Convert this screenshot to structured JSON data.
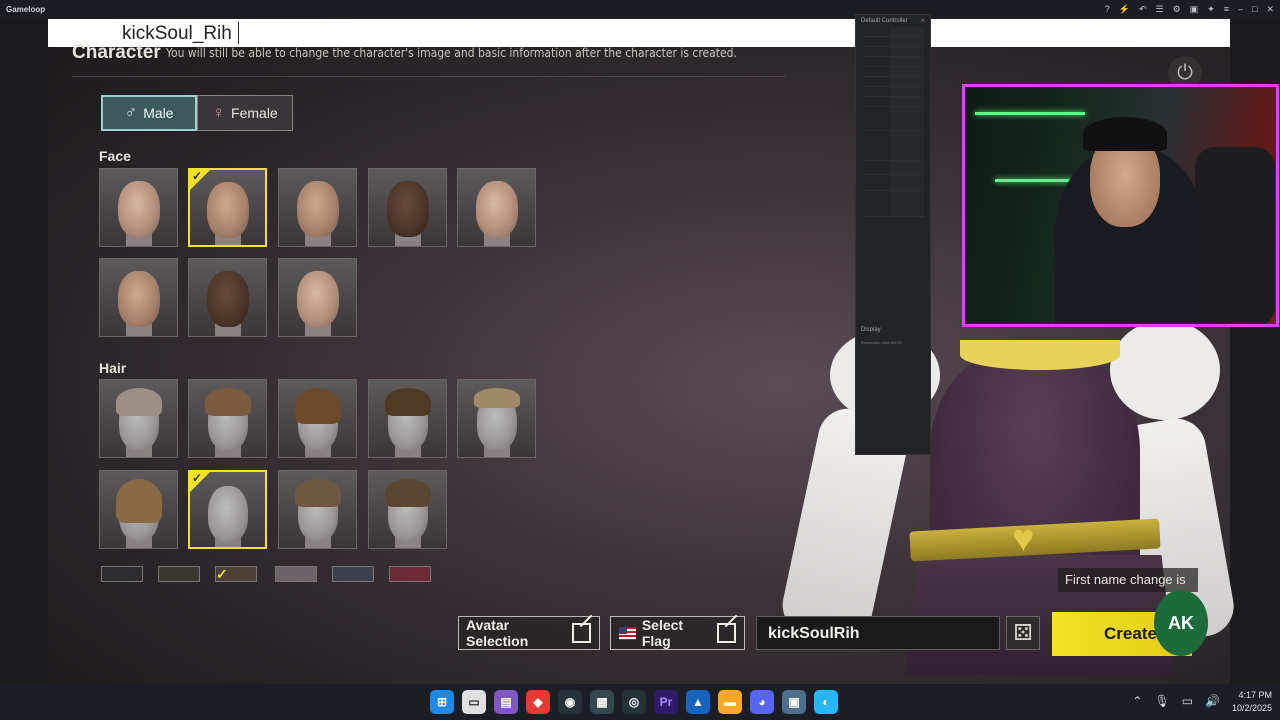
{
  "titlebar": {
    "app_name": "Gameloop"
  },
  "name_overlay": {
    "text": "kickSoul_Rih"
  },
  "header": {
    "title": "Character",
    "subtitle": "You will still be able to change the character's image and basic information after the character is created."
  },
  "gender": {
    "male_label": "Male",
    "female_label": "Female",
    "selected": "Male"
  },
  "face": {
    "label": "Face",
    "selected_index": 1,
    "count": 8
  },
  "hair": {
    "label": "Hair",
    "selected_index": 6,
    "count": 9
  },
  "actions": {
    "avatar_selection": "Avatar Selection",
    "select_flag": "Select Flag",
    "name_value": "kickSoulRih",
    "create": "Create",
    "first_name_hint": "First name change is"
  },
  "controller": {
    "title": "Default Controller",
    "display": "Display",
    "resolution": "Resolution Ultra HD 2K"
  },
  "logo": {
    "text": "AK"
  },
  "clock": {
    "time": "4:17 PM",
    "date": "10/2/2025"
  },
  "colors": {
    "accent": "#f3e12a",
    "selected_gender": "#3c5a5a",
    "cam_border": "#e040fb"
  }
}
